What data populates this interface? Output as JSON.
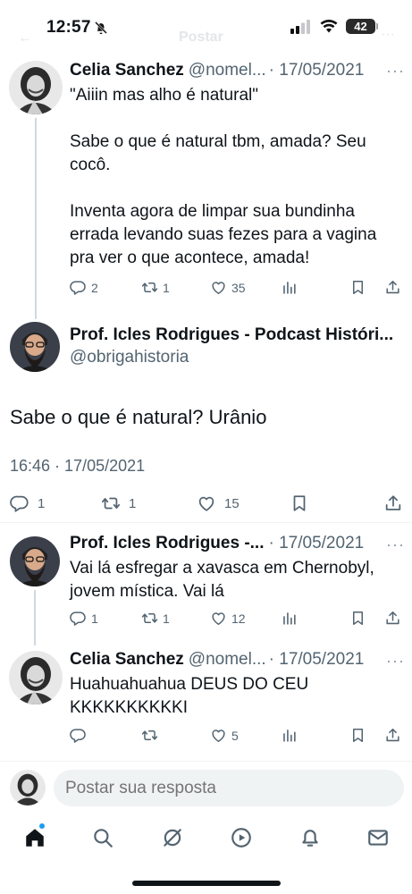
{
  "status_bar": {
    "time": "12:57",
    "battery": "42"
  },
  "faded_header": {
    "title": "Postar"
  },
  "tweets": [
    {
      "name": "Celia Sanchez",
      "handle": "@nomel...",
      "date": "· 17/05/2021",
      "text": "\"Aiiin mas alho é natural\"\n\nSabe o que é natural tbm, amada? Seu cocô.\n\nInventa agora de limpar sua bundinha errada levando suas fezes para a vagina pra ver o que acontece, amada!",
      "replies": "2",
      "retweets": "1",
      "likes": "35"
    }
  ],
  "main_tweet": {
    "name": "Prof. Icles Rodrigues - Podcast Históri...",
    "handle": "@obrigahistoria",
    "text": "Sabe o que é natural? Urânio",
    "timestamp": "16:46 · 17/05/2021",
    "replies": "1",
    "retweets": "1",
    "likes": "15"
  },
  "replies": [
    {
      "name": "Prof. Icles Rodrigues -...",
      "date": "· 17/05/2021",
      "text": "Vai lá esfregar a xavasca em Chernobyl, jovem mística. Vai lá",
      "replies": "1",
      "retweets": "1",
      "likes": "12"
    },
    {
      "name": "Celia Sanchez",
      "handle": "@nomel...",
      "date": "· 17/05/2021",
      "text": "Huahuahuahua DEUS DO CEU KKKKKKKKKKI",
      "likes": "5"
    }
  ],
  "reply_bar": {
    "placeholder": "Postar sua resposta"
  },
  "colors": {
    "accent": "#1d9bf0",
    "text": "#0f1419",
    "secondary": "#536471",
    "divider": "#eff3f4"
  },
  "icons": [
    "bell-slash-icon",
    "signal-icon",
    "wifi-icon",
    "reply-icon",
    "retweet-icon",
    "like-icon",
    "views-icon",
    "bookmark-icon",
    "share-icon",
    "home-icon",
    "search-icon",
    "grok-icon",
    "video-icon",
    "notifications-icon",
    "messages-icon"
  ]
}
